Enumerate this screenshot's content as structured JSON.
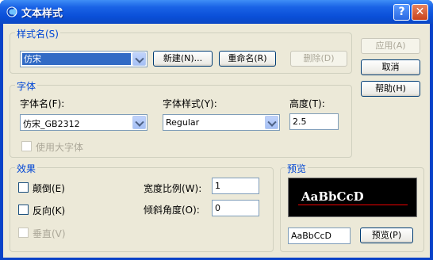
{
  "window": {
    "title": "文本样式",
    "help_glyph": "?",
    "close_glyph": "✕"
  },
  "style_name": {
    "group_title": "样式名(S)",
    "selected": "仿宋",
    "new_button": "新建(N)...",
    "rename_button": "重命名(R)",
    "delete_button": "删除(D)"
  },
  "font": {
    "group_title": "字体",
    "font_name_label": "字体名(F):",
    "font_name_value": "仿宋_GB2312",
    "font_style_label": "字体样式(Y):",
    "font_style_value": "Regular",
    "height_label": "高度(T):",
    "height_value": "2.5",
    "big_font_label": "使用大字体"
  },
  "effects": {
    "group_title": "效果",
    "upside_down_label": "颠倒(E)",
    "backwards_label": "反向(K)",
    "vertical_label": "垂直(V)",
    "width_factor_label": "宽度比例(W):",
    "width_factor_value": "1",
    "oblique_label": "倾斜角度(O):",
    "oblique_value": "0"
  },
  "preview": {
    "group_title": "预览",
    "sample": "AaBbCcD",
    "input_value": "AaBbCcD",
    "button": "预览(P)"
  },
  "actions": {
    "apply": "应用(A)",
    "cancel": "取消",
    "help": "帮助(H)"
  },
  "colors": {
    "title_bar": "#0a4fd8",
    "group_title": "#0046d5",
    "face": "#ece9d8"
  }
}
